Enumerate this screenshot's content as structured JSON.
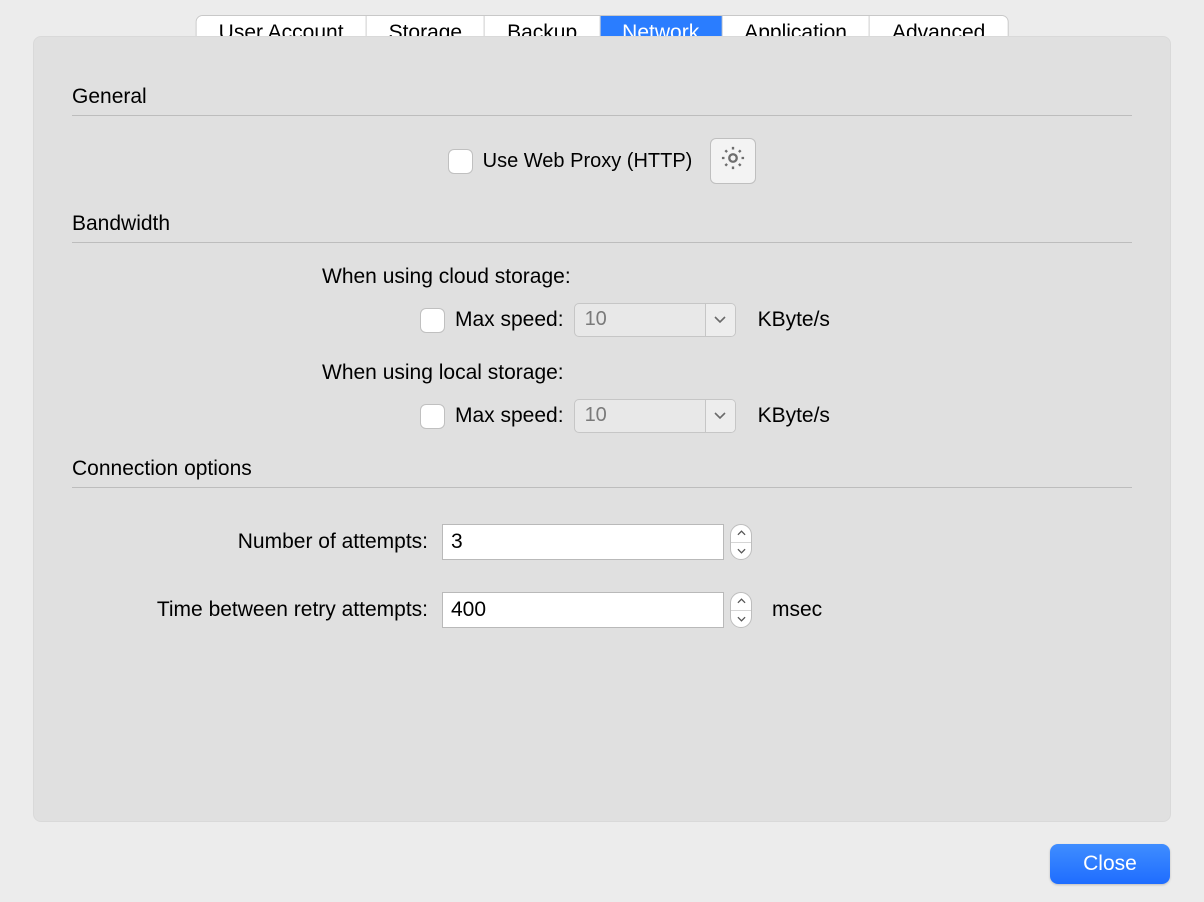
{
  "tabs": {
    "items": [
      {
        "label": "User Account",
        "active": false
      },
      {
        "label": "Storage",
        "active": false
      },
      {
        "label": "Backup",
        "active": false
      },
      {
        "label": "Network",
        "active": true
      },
      {
        "label": "Application",
        "active": false
      },
      {
        "label": "Advanced",
        "active": false
      }
    ]
  },
  "sections": {
    "general": {
      "title": "General",
      "proxy_label": "Use Web Proxy (HTTP)"
    },
    "bandwidth": {
      "title": "Bandwidth",
      "cloud": {
        "title": "When using cloud storage:",
        "max_speed_label": "Max speed:",
        "value": "10",
        "unit": "KByte/s"
      },
      "local": {
        "title": "When using local storage:",
        "max_speed_label": "Max speed:",
        "value": "10",
        "unit": "KByte/s"
      }
    },
    "connection": {
      "title": "Connection options",
      "attempts": {
        "label": "Number of attempts:",
        "value": "3"
      },
      "retry": {
        "label": "Time between retry attempts:",
        "value": "400",
        "unit": "msec"
      }
    }
  },
  "buttons": {
    "close": "Close"
  }
}
